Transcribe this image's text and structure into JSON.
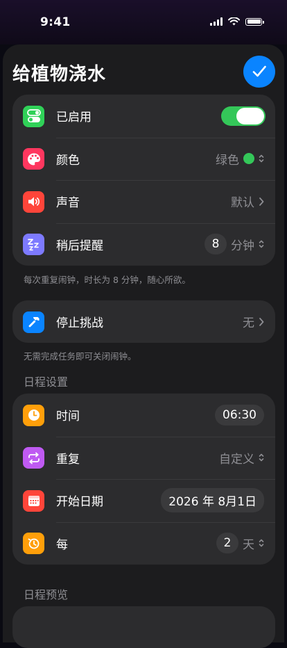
{
  "status": {
    "time": "9:41"
  },
  "header": {
    "title": "给植物浇水"
  },
  "alarm": {
    "enabled_label": "已启用",
    "color_label": "颜色",
    "color_value": "绿色",
    "sound_label": "声音",
    "sound_value": "默认",
    "snooze_label": "稍后提醒",
    "snooze_value": "8",
    "snooze_unit": "分钟",
    "snooze_note": "每次重复闹钟，时长为 8 分钟，随心所欲。"
  },
  "challenge": {
    "label": "停止挑战",
    "value": "无",
    "note": "无需完成任务即可关闭闹钟。"
  },
  "schedule": {
    "header": "日程设置",
    "time_label": "时间",
    "time_value": "06:30",
    "repeat_label": "重复",
    "repeat_value": "自定义",
    "start_label": "开始日期",
    "start_value": "2026 年 8月1日",
    "every_label": "每",
    "every_value": "2",
    "every_unit": "天"
  },
  "preview": {
    "header": "日程预览"
  },
  "colors": {
    "accent": "#0a84ff",
    "green": "#34c759",
    "card": "#2c2c2e",
    "sheet": "#1c1c1e"
  },
  "icons": {
    "enabled": "toggle-icon",
    "color": "palette-icon",
    "sound": "speaker-icon",
    "snooze": "zzz-icon",
    "challenge": "hammer-icon",
    "time": "clock-icon",
    "repeat": "repeat-icon",
    "start": "calendar-icon",
    "every": "history-icon"
  }
}
